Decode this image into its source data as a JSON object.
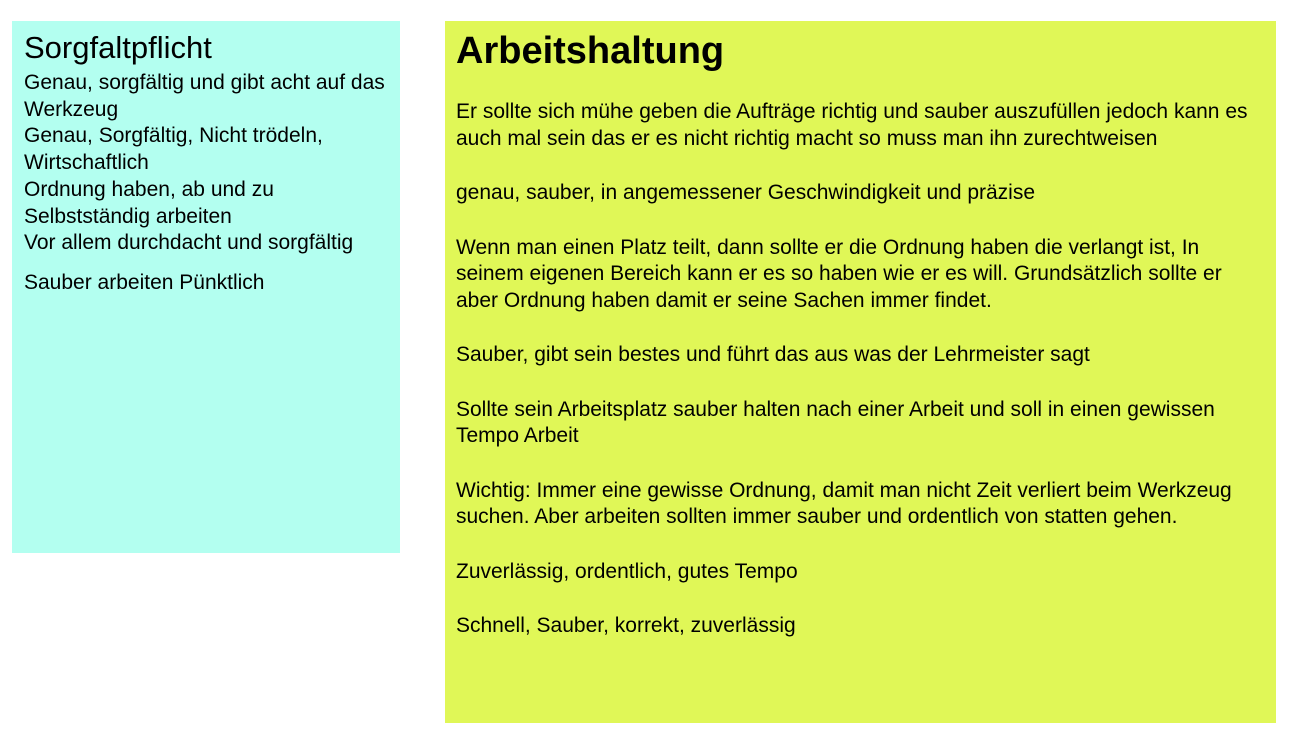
{
  "left_note": {
    "title": "Sorgfaltpflicht",
    "lines": [
      "Genau, sorgfältig und gibt acht auf das Werkzeug",
      "Genau, Sorgfältig, Nicht trödeln, Wirtschaftlich",
      "Ordnung haben, ab und zu Selbstständig arbeiten",
      "Vor allem durchdacht und sorgfältig",
      "Sauber arbeiten Pünktlich"
    ],
    "color": "#b3fff0"
  },
  "right_note": {
    "title": "Arbeitshaltung",
    "paragraphs": [
      "Er sollte sich mühe geben die Aufträge richtig und sauber auszufüllen jedoch kann es auch mal sein das er es nicht richtig macht so muss man ihn zurechtweisen",
      "genau, sauber, in angemessener Geschwindigkeit und präzise",
      "Wenn man einen Platz teilt, dann sollte er die Ordnung haben die verlangt ist, In seinem eigenen Bereich kann er es so haben wie er es will. Grundsätzlich sollte er aber Ordnung haben damit er seine Sachen immer findet.",
      "Sauber, gibt sein bestes und führt das aus was der Lehrmeister sagt",
      "Sollte sein Arbeitsplatz sauber halten nach einer Arbeit und soll in einen gewissen Tempo Arbeit",
      "Wichtig: Immer eine gewisse Ordnung, damit man nicht Zeit verliert beim Werkzeug suchen. Aber arbeiten sollten immer sauber und ordentlich von statten gehen.",
      "Zuverlässig, ordentlich, gutes Tempo",
      "Schnell, Sauber, korrekt, zuverlässig"
    ],
    "color": "#e0f757"
  }
}
